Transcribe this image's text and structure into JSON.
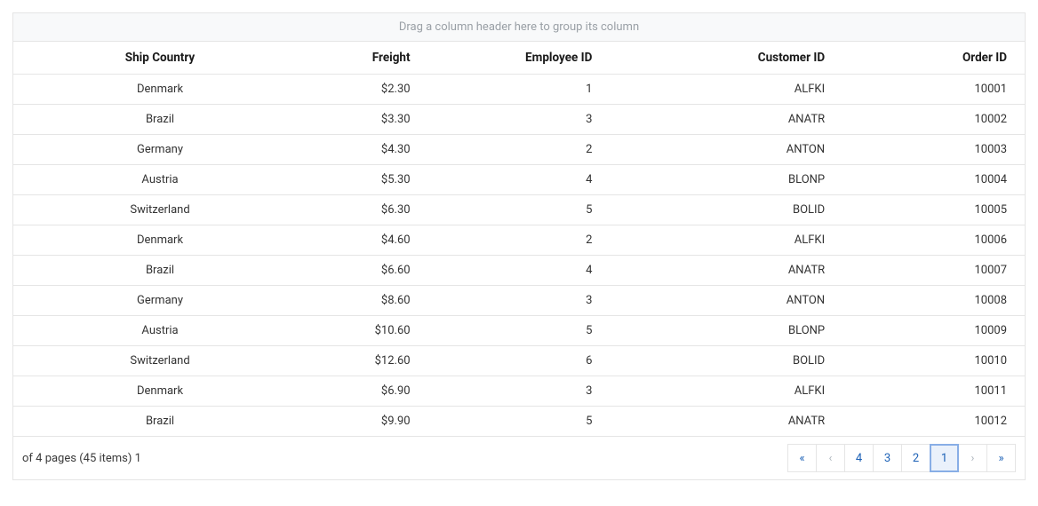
{
  "group_drop_text": "Drag a column header here to group its column",
  "columns": [
    {
      "key": "ship_country",
      "label": "Ship Country"
    },
    {
      "key": "freight",
      "label": "Freight"
    },
    {
      "key": "employee_id",
      "label": "Employee ID"
    },
    {
      "key": "customer_id",
      "label": "Customer ID"
    },
    {
      "key": "order_id",
      "label": "Order ID"
    }
  ],
  "rows": [
    {
      "ship_country": "Denmark",
      "freight": "$2.30",
      "employee_id": "1",
      "customer_id": "ALFKI",
      "order_id": "10001"
    },
    {
      "ship_country": "Brazil",
      "freight": "$3.30",
      "employee_id": "3",
      "customer_id": "ANATR",
      "order_id": "10002"
    },
    {
      "ship_country": "Germany",
      "freight": "$4.30",
      "employee_id": "2",
      "customer_id": "ANTON",
      "order_id": "10003"
    },
    {
      "ship_country": "Austria",
      "freight": "$5.30",
      "employee_id": "4",
      "customer_id": "BLONP",
      "order_id": "10004"
    },
    {
      "ship_country": "Switzerland",
      "freight": "$6.30",
      "employee_id": "5",
      "customer_id": "BOLID",
      "order_id": "10005"
    },
    {
      "ship_country": "Denmark",
      "freight": "$4.60",
      "employee_id": "2",
      "customer_id": "ALFKI",
      "order_id": "10006"
    },
    {
      "ship_country": "Brazil",
      "freight": "$6.60",
      "employee_id": "4",
      "customer_id": "ANATR",
      "order_id": "10007"
    },
    {
      "ship_country": "Germany",
      "freight": "$8.60",
      "employee_id": "3",
      "customer_id": "ANTON",
      "order_id": "10008"
    },
    {
      "ship_country": "Austria",
      "freight": "$10.60",
      "employee_id": "5",
      "customer_id": "BLONP",
      "order_id": "10009"
    },
    {
      "ship_country": "Switzerland",
      "freight": "$12.60",
      "employee_id": "6",
      "customer_id": "BOLID",
      "order_id": "10010"
    },
    {
      "ship_country": "Denmark",
      "freight": "$6.90",
      "employee_id": "3",
      "customer_id": "ALFKI",
      "order_id": "10011"
    },
    {
      "ship_country": "Brazil",
      "freight": "$9.90",
      "employee_id": "5",
      "customer_id": "ANATR",
      "order_id": "10012"
    }
  ],
  "pager": {
    "info_text": "of 4 pages (45 items) 1",
    "pages": [
      "4",
      "3",
      "2",
      "1"
    ],
    "current": "1",
    "first_icon": "«",
    "prev_icon": "‹",
    "next_icon": "›",
    "last_icon": "»"
  }
}
